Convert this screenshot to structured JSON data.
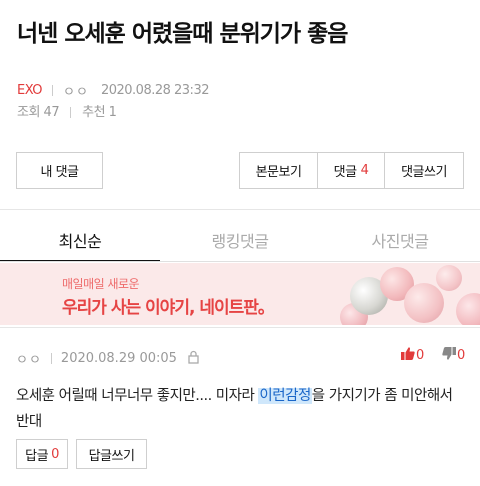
{
  "post": {
    "title": "너넨 오세훈 어렸을때 분위기가 좋음",
    "category": "EXO",
    "author": "ㅇㅇ",
    "datetime": "2020.08.28 23:32",
    "views_label": "조회 47",
    "recommends_label": "추천 1"
  },
  "buttons": {
    "my_comments": "내 댓글",
    "view_body": "본문보기",
    "comments_label": "댓글",
    "comments_count": "4",
    "write_comment": "댓글쓰기"
  },
  "tabs": [
    {
      "label": "최신순",
      "active": true
    },
    {
      "label": "랭킹댓글",
      "active": false
    },
    {
      "label": "사진댓글",
      "active": false
    }
  ],
  "banner": {
    "small_text": "매일매일 새로운",
    "big_text": "우리가 사는 이야기, 네이트판。"
  },
  "comment": {
    "author": "ㅇㅇ",
    "datetime": "2020.08.29 00:05",
    "up_count": "0",
    "down_count": "0",
    "text_before": "오세훈 어릴때 너무너무 좋지만.... 미자라 ",
    "text_highlight": "이런감정",
    "text_after": "을 가지기가 좀 미안해서 반대",
    "reply_label": "답글",
    "reply_count": "0",
    "write_reply_label": "답글쓰기"
  },
  "colors": {
    "accent": "#e23b3b",
    "highlight_bg": "#cfe7fb",
    "highlight_text": "#1a66c8",
    "banner_bg": "#fbe9e9"
  },
  "icons": [
    "lock-icon",
    "thumbs-up-icon",
    "thumbs-down-icon"
  ]
}
